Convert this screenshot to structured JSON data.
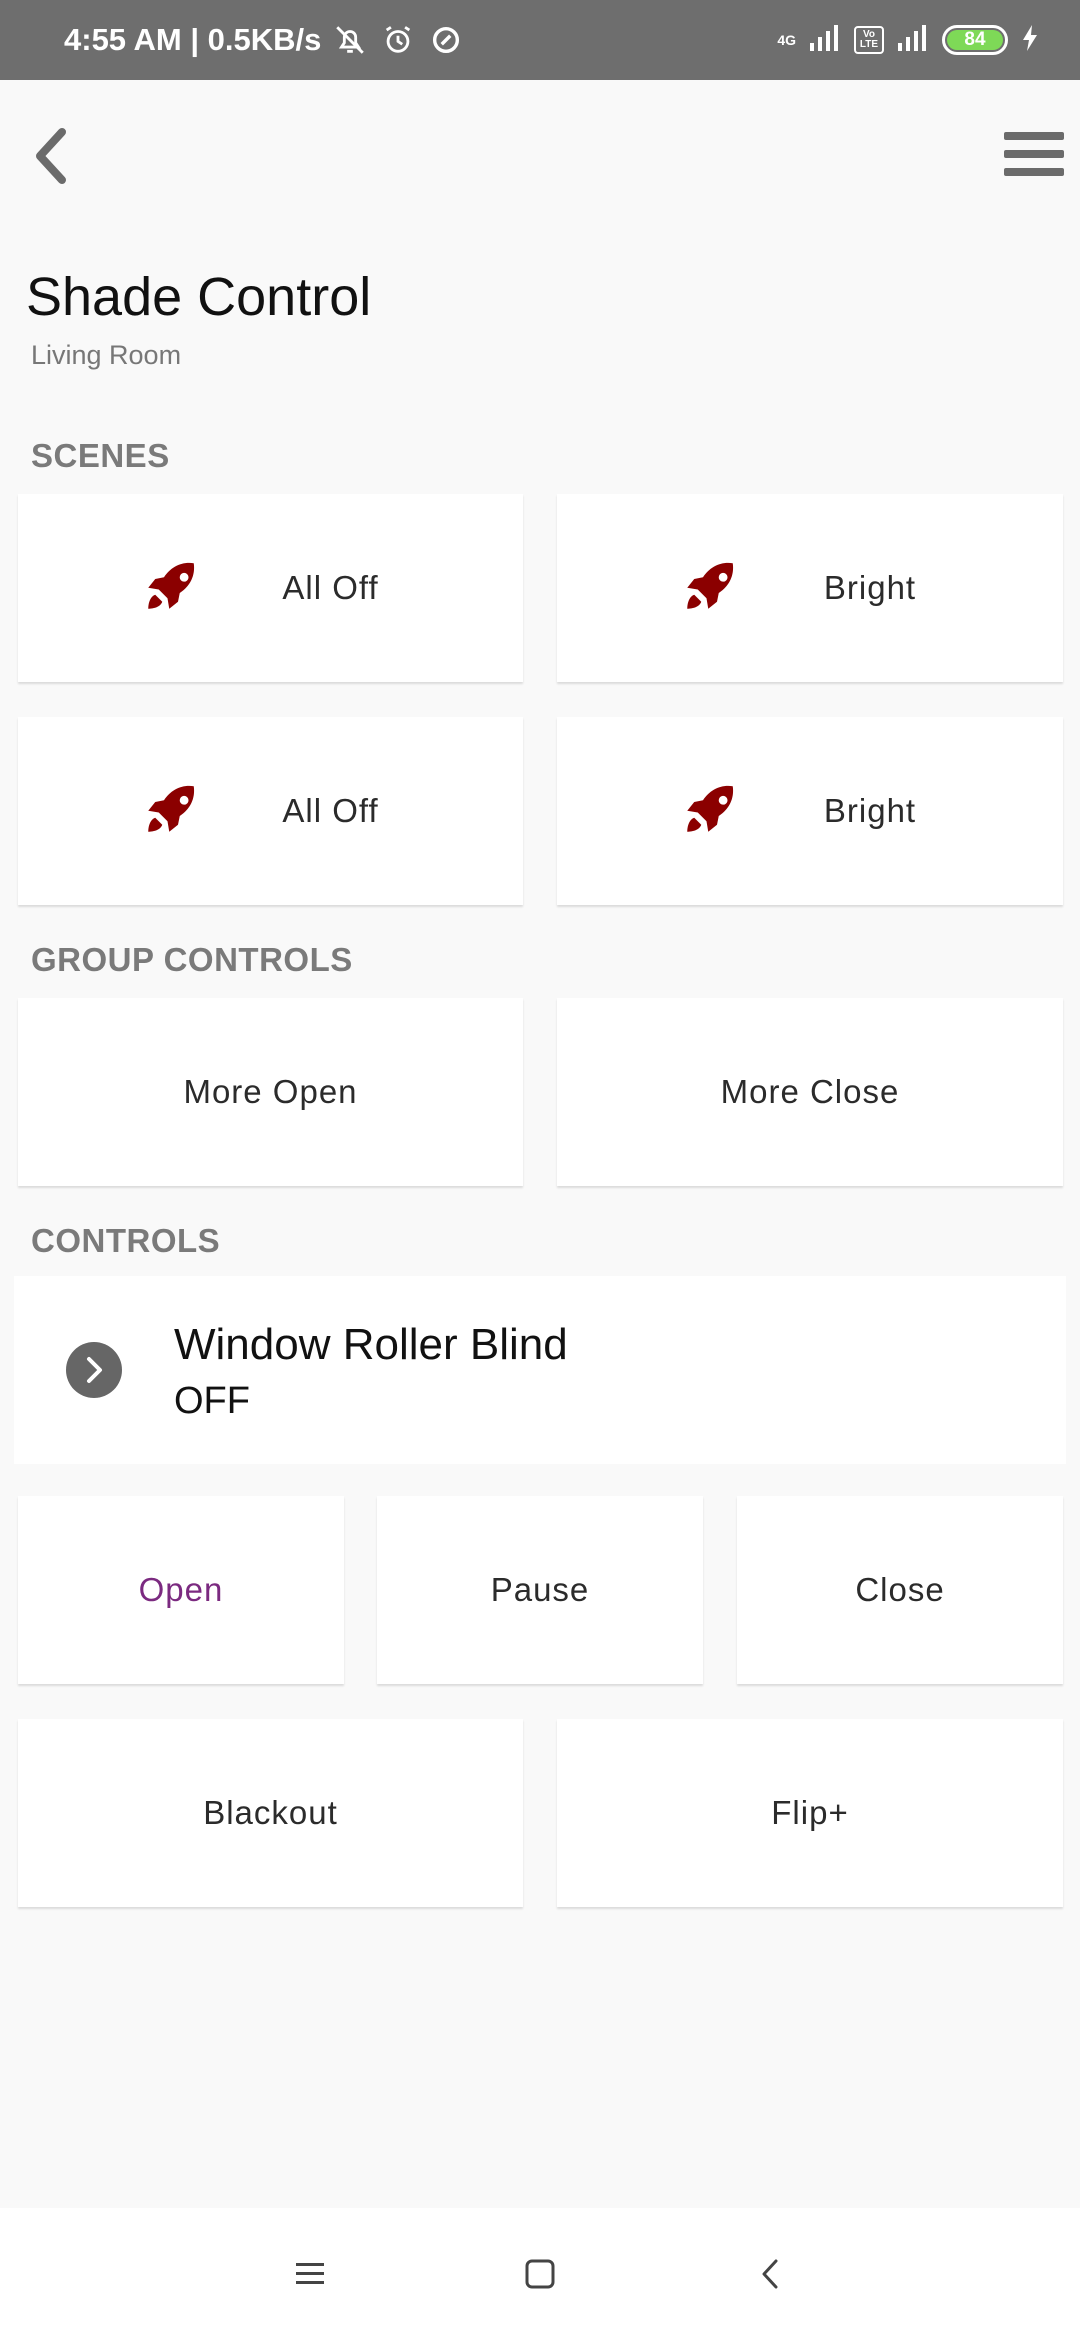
{
  "status_bar": {
    "time_speed": "4:55 AM | 0.5KB/s",
    "network_tag": "4G",
    "volte_tag": "Vo LTE",
    "battery_level": "84"
  },
  "header": {
    "title": "Shade Control",
    "subtitle": "Living Room"
  },
  "sections": {
    "scenes": "SCENES",
    "group_controls": "GROUP CONTROLS",
    "controls": "CONTROLS"
  },
  "scenes": [
    {
      "label": "All Off",
      "icon": "rocket-icon"
    },
    {
      "label": "Bright",
      "icon": "rocket-icon"
    },
    {
      "label": "All Off",
      "icon": "rocket-icon"
    },
    {
      "label": "Bright",
      "icon": "rocket-icon"
    }
  ],
  "group_controls": [
    {
      "label": "More Open"
    },
    {
      "label": "More Close"
    }
  ],
  "device": {
    "name": "Window Roller Blind",
    "state": "OFF"
  },
  "device_actions": [
    {
      "label": "Open"
    },
    {
      "label": "Pause"
    },
    {
      "label": "Close"
    },
    {
      "label": "Blackout"
    },
    {
      "label": "Flip+"
    }
  ],
  "colors": {
    "rocket": "#8b0000",
    "active_action": "#7b2a80",
    "section_label": "#7a7a7a",
    "status_bar": "#6e6e6e"
  }
}
